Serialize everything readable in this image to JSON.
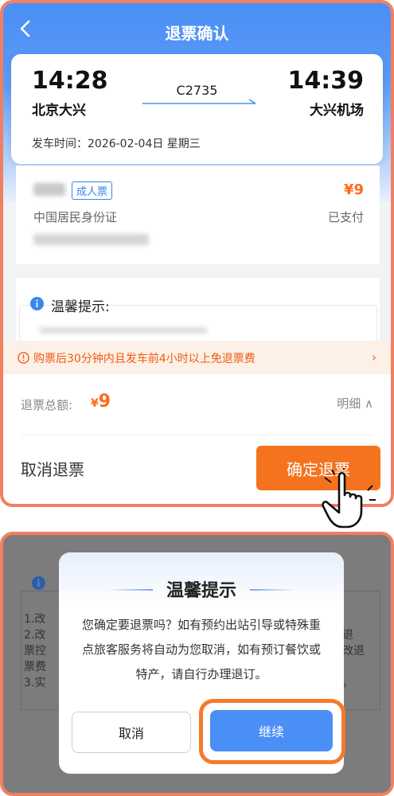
{
  "screen1": {
    "header": {
      "title": "退票确认"
    },
    "trip": {
      "depart_time": "14:28",
      "arrive_time": "14:39",
      "depart_station": "北京大兴",
      "arrive_station": "大兴机场",
      "train_number": "C2735",
      "depart_date": "发车时间：2026-02-04日 星期三"
    },
    "passenger": {
      "ticket_type": "成人票",
      "price": "¥9",
      "id_type": "中国居民身份证",
      "payment_status": "已支付"
    },
    "tips": {
      "title": "温馨提示:"
    },
    "notice": {
      "text": "购票后30分钟内且发车前4小时以上免退票费",
      "arrow": "›"
    },
    "refund": {
      "label": "退票总额:",
      "currency": "¥",
      "amount": "9",
      "detail_label": "明细 ∧"
    },
    "actions": {
      "cancel_label": "取消退票",
      "confirm_label": "确定退票"
    }
  },
  "screen2": {
    "background": {
      "lines_left": [
        "1.改",
        "2.改",
        "票控",
        "票费",
        "3.实"
      ],
      "lines_right": [
        "退",
        "改退",
        "。"
      ]
    },
    "modal": {
      "title": "温馨提示",
      "message": "您确定要退票吗？如有预约出站引导或特殊重点旅客服务将自动为您取消，如有预订餐饮或特产，请自行办理退订。",
      "cancel_label": "取消",
      "continue_label": "继续"
    }
  },
  "colors": {
    "primary_blue": "#4a8ff5",
    "accent_orange": "#f5731f",
    "highlight_border": "#f08060"
  }
}
